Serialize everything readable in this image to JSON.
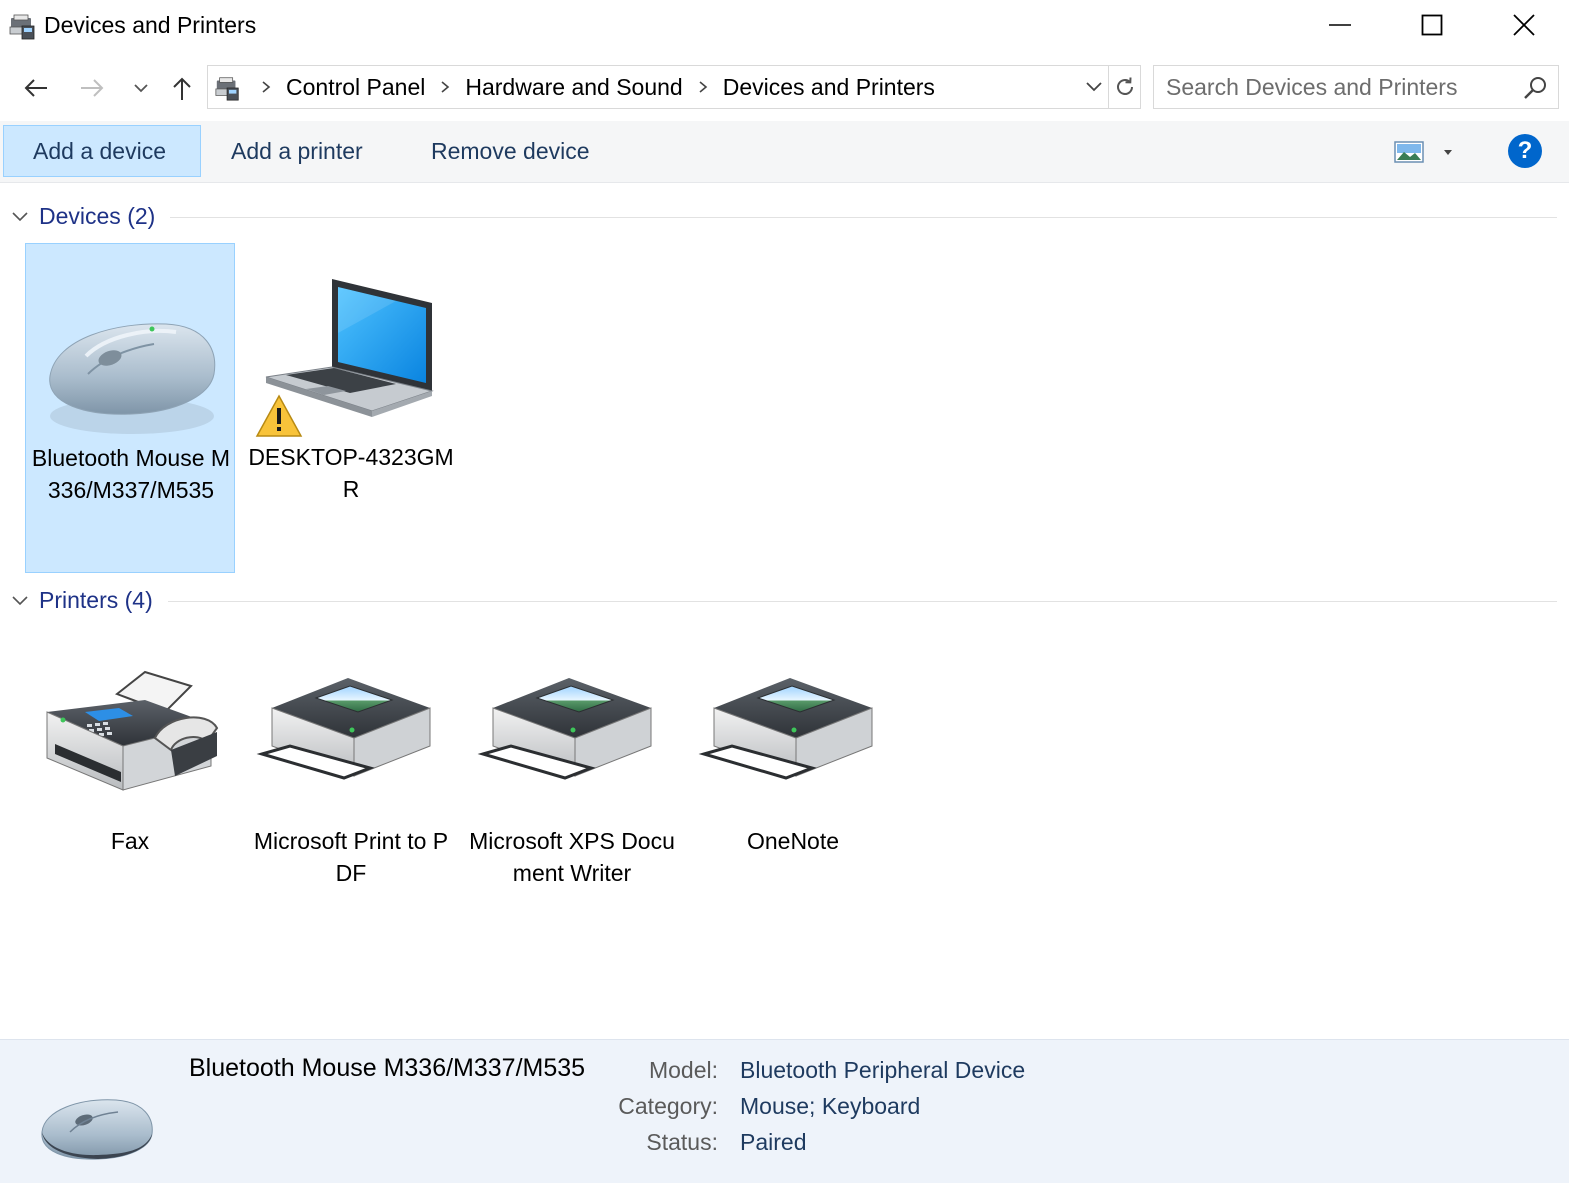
{
  "window": {
    "title": "Devices and Printers"
  },
  "address": {
    "crumbs": [
      "Control Panel",
      "Hardware and Sound",
      "Devices and Printers"
    ]
  },
  "search": {
    "placeholder": "Search Devices and Printers"
  },
  "toolbar": {
    "add_device": "Add a device",
    "add_printer": "Add a printer",
    "remove_device": "Remove device",
    "help": "?"
  },
  "groups": {
    "devices": {
      "label": "Devices (2)",
      "items": [
        {
          "name": "Bluetooth Mouse M336/M337/M535",
          "selected": true,
          "icon": "mouse-icon"
        },
        {
          "name": "DESKTOP-4323GMR",
          "warning": true,
          "icon": "laptop-icon"
        }
      ]
    },
    "printers": {
      "label": "Printers (4)",
      "items": [
        {
          "name": "Fax",
          "icon": "fax-icon"
        },
        {
          "name": "Microsoft Print to PDF",
          "icon": "printer-icon"
        },
        {
          "name": "Microsoft XPS Document Writer",
          "icon": "printer-icon"
        },
        {
          "name": "OneNote",
          "icon": "printer-icon"
        }
      ]
    }
  },
  "details": {
    "title": "Bluetooth Mouse M336/M337/M535",
    "model_label": "Model:",
    "model_value": "Bluetooth Peripheral Device",
    "category_label": "Category:",
    "category_value": "Mouse; Keyboard",
    "status_label": "Status:",
    "status_value": "Paired"
  },
  "colors": {
    "selection": "#cce8ff",
    "link_blue": "#1e3287",
    "help_blue": "#0066cc"
  }
}
